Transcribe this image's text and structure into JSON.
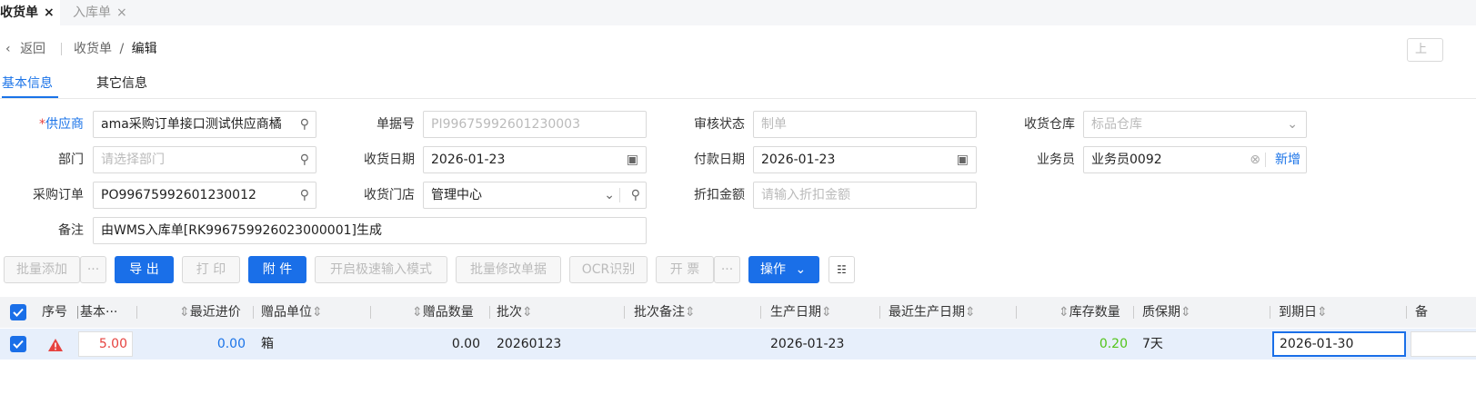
{
  "tabs": [
    {
      "label": "收货单",
      "close": "×"
    },
    {
      "label": "入库单",
      "close": "×"
    }
  ],
  "header": {
    "back": "返回",
    "breadcrumb_parent": "收货单",
    "breadcrumb_sep": "/",
    "breadcrumb_current": "编辑",
    "corner": "上"
  },
  "subtabs": [
    "基本信息",
    "其它信息"
  ],
  "form": {
    "supplier_label": "供应商",
    "supplier_required": "*",
    "supplier_value": "ama采购订单接口测试供应商橘",
    "doc_no_label": "单据号",
    "doc_no_value": "PI99675992601230003",
    "audit_label": "审核状态",
    "audit_value": "制单",
    "warehouse_label": "收货仓库",
    "warehouse_value": "标品仓库",
    "dept_label": "部门",
    "dept_placeholder": "请选择部门",
    "recv_date_label": "收货日期",
    "recv_date_value": "2026-01-23",
    "pay_date_label": "付款日期",
    "pay_date_value": "2026-01-23",
    "salesman_label": "业务员",
    "salesman_value": "业务员0092",
    "salesman_add": "新增",
    "po_label": "采购订单",
    "po_value": "PO99675992601230012",
    "store_label": "收货门店",
    "store_value": "管理中心",
    "discount_label": "折扣金额",
    "discount_placeholder": "请输入折扣金额",
    "remark_label": "备注",
    "remark_value": "由WMS入库单[RK996759926023000001]生成"
  },
  "toolbar": {
    "batch_add": "批量添加",
    "more": "···",
    "export": "导 出",
    "print": "打 印",
    "attach": "附 件",
    "fast_input": "开启极速输入模式",
    "batch_modify": "批量修改单据",
    "ocr": "OCR识别",
    "invoice": "开 票",
    "operate": "操作"
  },
  "table": {
    "headers": {
      "seq": "序号",
      "base_qty": "基本···",
      "last_price": "最近进价",
      "gift_unit": "赠品单位",
      "gift_qty": "赠品数量",
      "batch": "批次",
      "batch_remark": "批次备注",
      "prod_date": "生产日期",
      "last_prod_date": "最近生产日期",
      "stock_qty": "库存数量",
      "shelf_life": "质保期",
      "expiry": "到期日",
      "more": "备"
    },
    "rows": [
      {
        "base_qty": "5.00",
        "last_price": "0.00",
        "gift_unit": "箱",
        "gift_qty": "0.00",
        "batch": "20260123",
        "prod_date": "2026-01-23",
        "stock_qty": "0.20",
        "shelf_life": "7天",
        "expiry": "2026-01-30"
      }
    ]
  },
  "colors": {
    "accent": "#1a6fe8",
    "danger": "#e64340",
    "success": "#52c41a",
    "row_selected": "#e7effb"
  }
}
